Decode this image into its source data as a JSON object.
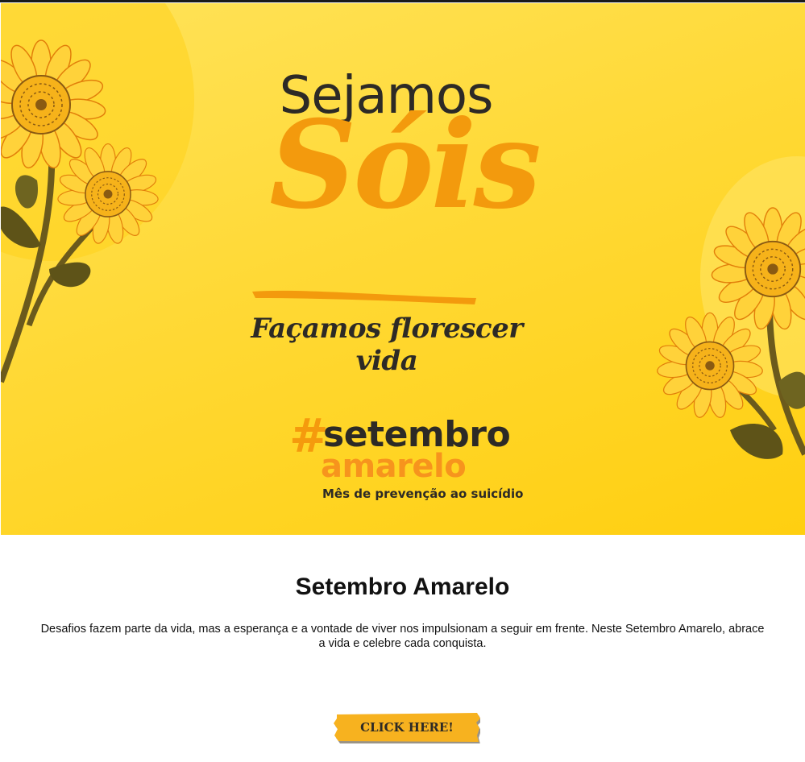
{
  "banner": {
    "headline_top": "Sejamos",
    "headline_main": "Sóis",
    "tagline": "Façamos florescer vida",
    "hashtag_symbol": "#",
    "hashtag_word": "setembro",
    "hashtag_word2": "amarelo",
    "subtitle": "Mês de prevenção ao suicídio"
  },
  "content": {
    "title": "Setembro Amarelo",
    "description_line1": "Desafios fazem parte da vida, mas a esperança e a vontade de viver nos impulsionam a seguir em frente. Neste Setembro Amarelo, abrace",
    "description_line2": "a vida e celebre cada conquista."
  },
  "cta": {
    "label": "CLICK HERE!"
  },
  "colors": {
    "banner_yellow": "#ffd936",
    "accent_orange": "#f39a0d",
    "dark_text": "#2d2a26",
    "button_yellow": "#f7b21f"
  }
}
